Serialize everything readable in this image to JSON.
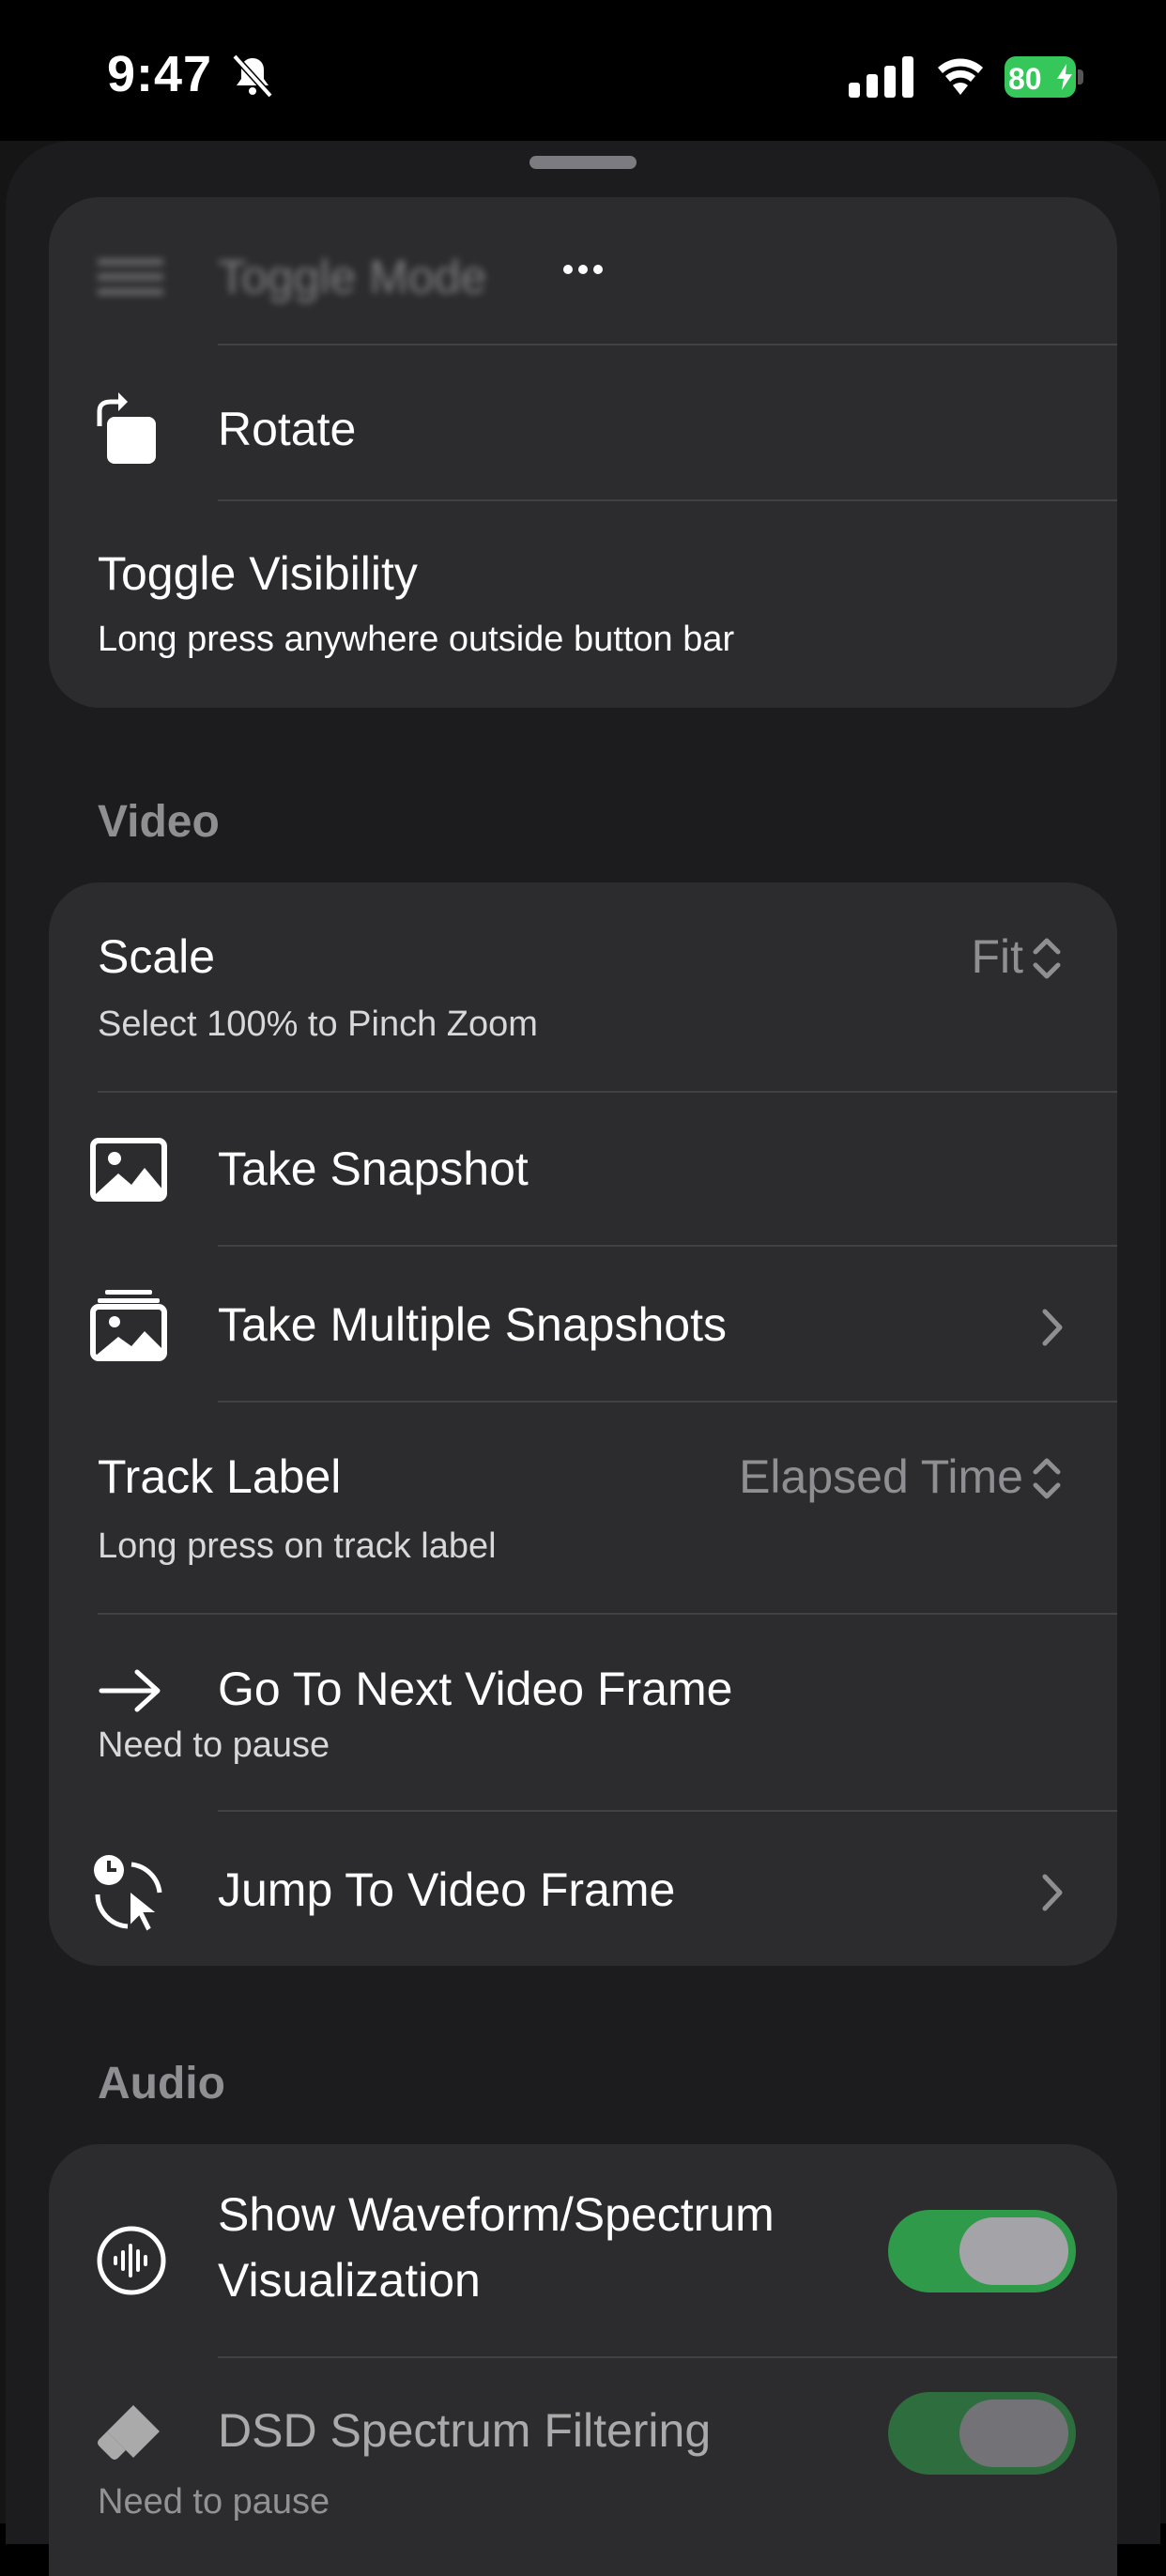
{
  "status_bar": {
    "time": "9:47",
    "battery": "80"
  },
  "top_card": {
    "header_title": "Toggle Mode",
    "rotate_label": "Rotate",
    "toggle_visibility_label": "Toggle Visibility",
    "toggle_visibility_sub": "Long press anywhere outside button bar"
  },
  "video": {
    "section_title": "Video",
    "scale_label": "Scale",
    "scale_value": "Fit",
    "scale_sub": "Select 100% to Pinch Zoom",
    "take_snapshot": "Take Snapshot",
    "take_multiple_snapshots": "Take Multiple Snapshots",
    "track_label": "Track Label",
    "track_label_value": "Elapsed Time",
    "track_label_sub": "Long press on track label",
    "next_frame": "Go To Next Video Frame",
    "next_frame_sub": "Need to pause",
    "jump_frame": "Jump To Video Frame"
  },
  "audio": {
    "section_title": "Audio",
    "waveform_line1": "Show Waveform/Spectrum",
    "waveform_line2": "Visualization",
    "waveform_on": true,
    "dsd_label": "DSD Spectrum Filtering",
    "dsd_sub": "Need to pause",
    "dsd_on": true
  },
  "colors": {
    "toggle_on": "#30d158",
    "background": "#1c1c1e",
    "card": "#2c2c2e"
  }
}
